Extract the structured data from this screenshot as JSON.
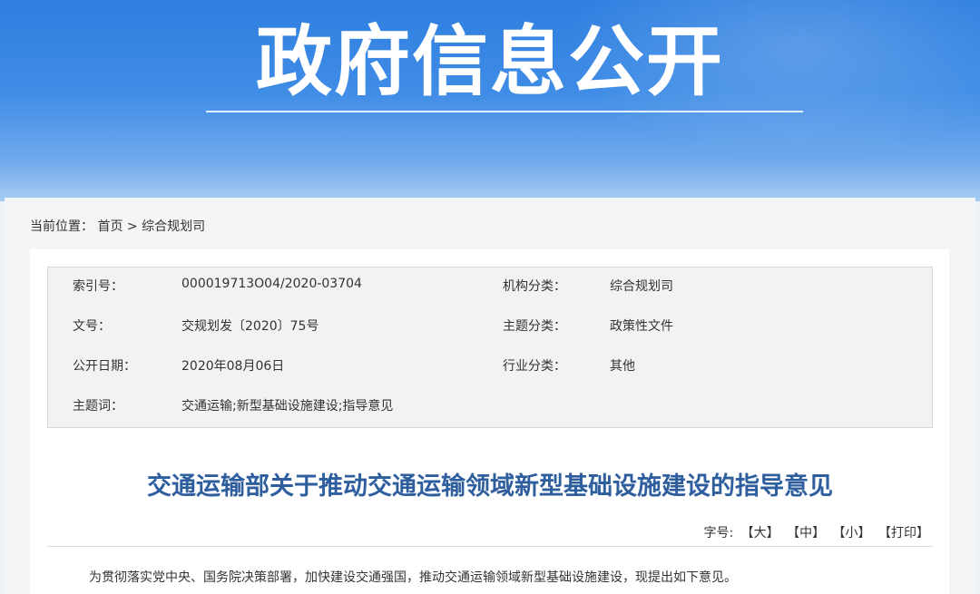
{
  "banner": {
    "title": "政府信息公开"
  },
  "breadcrumb": {
    "prefix": "当前位置：",
    "home": "首页",
    "separator": ">",
    "current": "综合规划司"
  },
  "meta": {
    "index_label": "索引号：",
    "index_value": "000019713O04/2020-03704",
    "org_label": "机构分类：",
    "org_value": "综合规划司",
    "docno_label": "文号：",
    "docno_value": "交规划发〔2020〕75号",
    "subject_label": "主题分类：",
    "subject_value": "政策性文件",
    "date_label": "公开日期：",
    "date_value": "2020年08月06日",
    "industry_label": "行业分类：",
    "industry_value": "其他",
    "keywords_label": "主题词：",
    "keywords_value": "交通运输;新型基础设施建设;指导意见"
  },
  "document": {
    "title": "交通运输部关于推动交通运输领域新型基础设施建设的指导意见",
    "intro": "为贯彻落实党中央、国务院决策部署，加快建设交通强国，推动交通运输领域新型基础设施建设，现提出如下意见。"
  },
  "toolbar": {
    "font_label": "字号:",
    "large": "【大】",
    "medium": "【中】",
    "small": "【小】",
    "print": "【打印】"
  },
  "colors": {
    "banner_blue": "#3f8ce6",
    "title_blue": "#2f5e9e"
  }
}
